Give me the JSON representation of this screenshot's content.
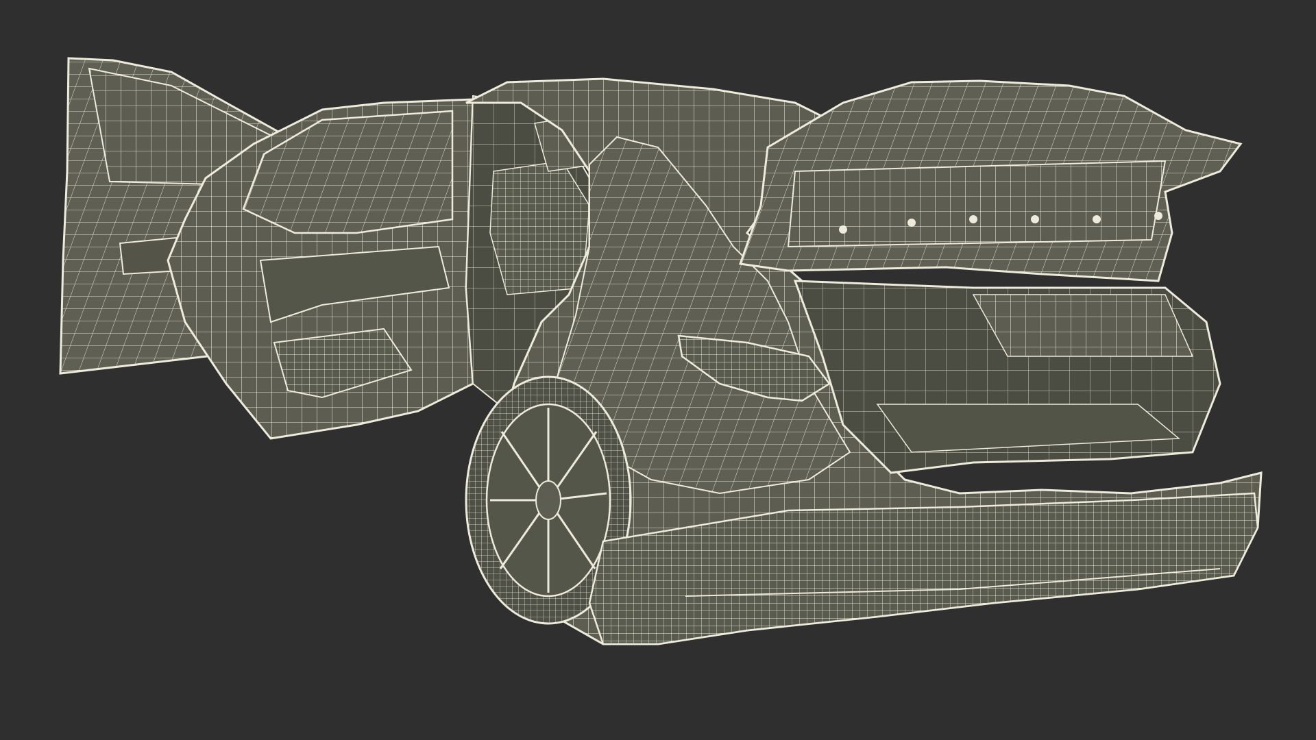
{
  "scene": {
    "subject": "sedan-wireframe-render",
    "background_color": "#2f2f2f",
    "surface_color": "#5d5e51",
    "surface_dark_color": "#4a4b40",
    "wire_color": "#ecebdc",
    "doors_open": [
      "front-left-door",
      "rear-left-door",
      "trunk-lid"
    ]
  }
}
